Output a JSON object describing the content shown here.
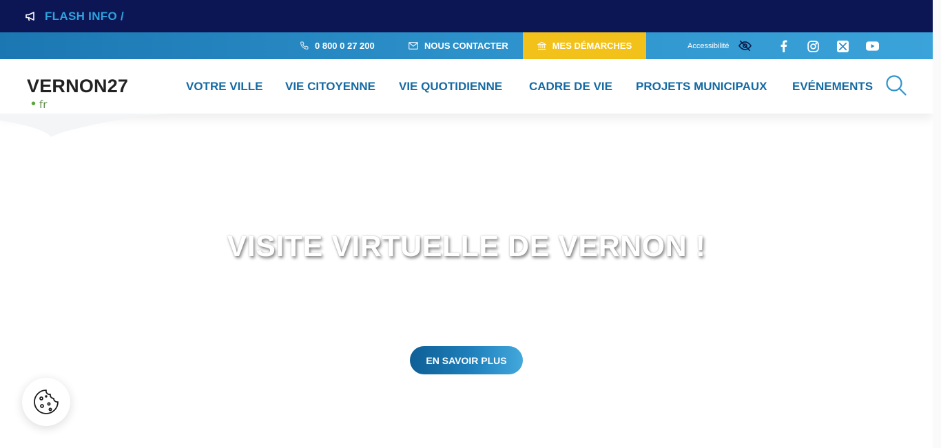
{
  "flash": {
    "label": "FLASH INFO /",
    "icon": "megaphone-icon"
  },
  "utility": {
    "phone": "0 800 0 27 200",
    "contact": "NOUS CONTACTER",
    "demarches": "MES DÉMARCHES",
    "accessibility": "Accessibilité",
    "social": [
      "facebook-icon",
      "instagram-icon",
      "x-twitter-icon",
      "youtube-icon"
    ]
  },
  "logo": {
    "name": "VERNON27",
    "dot": "•",
    "tld": "fr"
  },
  "nav": {
    "items": [
      "VOTRE VILLE",
      "VIE CITOYENNE",
      "VIE QUOTIDIENNE",
      "CADRE DE VIE",
      "PROJETS MUNICIPAUX",
      "EVÉNEMENTS"
    ]
  },
  "hero": {
    "title": "VISITE VIRTUELLE DE VERNON !",
    "button": "EN SAVOIR PLUS"
  },
  "colors": {
    "flash_bg": "#0c1654",
    "flash_text": "#2ea3e0",
    "utility_bg": "#2e93cc",
    "demarches_bg": "#f2c21b",
    "nav_text": "#156aa3",
    "logo_green": "#5aa63e"
  }
}
